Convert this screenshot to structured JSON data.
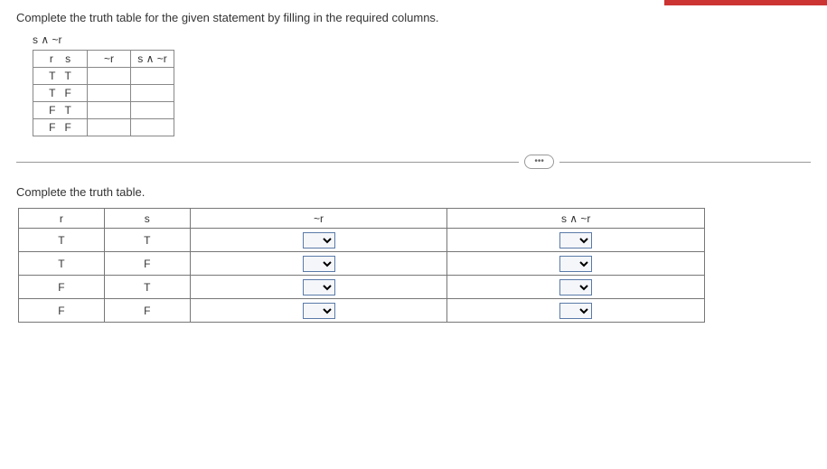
{
  "instruction": "Complete the truth table for the given statement by filling in the required columns.",
  "expression": "s ∧ ~r",
  "small_table": {
    "headers": {
      "rs": "r    s",
      "notr": "~r",
      "s_and_notr": "s ∧ ~r"
    },
    "rows": [
      {
        "r": "T",
        "s": "T"
      },
      {
        "r": "T",
        "s": "F"
      },
      {
        "r": "F",
        "s": "T"
      },
      {
        "r": "F",
        "s": "F"
      }
    ]
  },
  "ellipsis": "•••",
  "sub_instruction": "Complete the truth table.",
  "main_table": {
    "headers": {
      "r": "r",
      "s": "s",
      "notr": "~r",
      "s_and_notr": "s ∧ ~r"
    },
    "rows": [
      {
        "r": "T",
        "s": "T"
      },
      {
        "r": "T",
        "s": "F"
      },
      {
        "r": "F",
        "s": "T"
      },
      {
        "r": "F",
        "s": "F"
      }
    ]
  }
}
